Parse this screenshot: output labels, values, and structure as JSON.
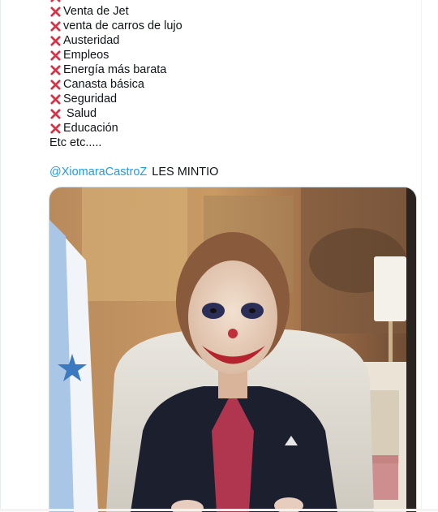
{
  "tweet": {
    "items": [
      {
        "mark": "cross-mark",
        "text": "Venta de Jet"
      },
      {
        "mark": "cross-mark",
        "text": "venta de carros de lujo"
      },
      {
        "mark": "cross-mark",
        "text": "Austeridad"
      },
      {
        "mark": "cross-mark",
        "text": "Empleos"
      },
      {
        "mark": "cross-mark",
        "text": "Energía más barata"
      },
      {
        "mark": "cross-mark",
        "text": "Canasta básica"
      },
      {
        "mark": "cross-mark",
        "text": "Seguridad"
      },
      {
        "mark": "cross-mark",
        "text": " Salud"
      },
      {
        "mark": "cross-mark",
        "text": "Educación"
      }
    ],
    "etc_text": "Etc etc.....",
    "mention": "@XiomaraCastroZ",
    "after_mention": "LES MINTIO"
  },
  "colors": {
    "cross_red": "#dd2e44",
    "link_blue": "#1d9bf0",
    "text": "#0f1419"
  },
  "media": {
    "type": "photo"
  }
}
